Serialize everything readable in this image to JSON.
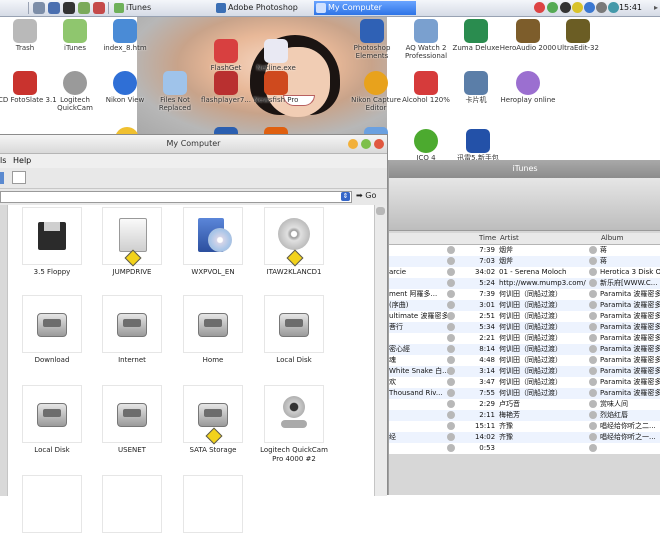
{
  "taskbar": {
    "tasks": [
      {
        "label": "iTunes"
      },
      {
        "label": "Adobe Photoshop"
      },
      {
        "label": "My Computer"
      }
    ],
    "clock": "15:41"
  },
  "desktop_icons": [
    {
      "label": "Trash"
    },
    {
      "label": "iTunes"
    },
    {
      "label": "index_8.htm"
    },
    {
      "label": "FlashGet"
    },
    {
      "label": "Netline.exe"
    },
    {
      "label": "Photoshop Elements"
    },
    {
      "label": "AQ Watch 2 Professional"
    },
    {
      "label": "Zuma Deluxe"
    },
    {
      "label": "HeroAudio 2000"
    },
    {
      "label": "UltraEdit-32"
    },
    {
      "label": "ACD FotoSlate 3.1"
    },
    {
      "label": "Logitech QuickCam"
    },
    {
      "label": "Nikon View"
    },
    {
      "label": "Files Not Replaced"
    },
    {
      "label": "flashplayer7..."
    },
    {
      "label": "Newsfish Pro"
    },
    {
      "label": "Nikon Capture Editor"
    },
    {
      "label": "Alcohol 120%"
    },
    {
      "label": "卡片机"
    },
    {
      "label": "Heroplay online"
    },
    {
      "label": "ICQ 4"
    },
    {
      "label": "迅雷5.新手包"
    }
  ],
  "my_computer": {
    "title": "My Computer",
    "menu": [
      "ls",
      "Help"
    ],
    "go_label": "Go",
    "drives": [
      {
        "label": "3.5 Floppy",
        "kind": "floppy-icon"
      },
      {
        "label": "JUMPDRIVE",
        "kind": "usb-drive-icon"
      },
      {
        "label": "WXPVOL_EN",
        "kind": "cd-install-icon"
      },
      {
        "label": "ITAW2KLANCD1",
        "kind": "cd-icon"
      },
      {
        "label": "Download",
        "kind": "hard-disk-icon"
      },
      {
        "label": "Internet",
        "kind": "hard-disk-icon"
      },
      {
        "label": "Home",
        "kind": "hard-disk-icon"
      },
      {
        "label": "Local Disk",
        "kind": "hard-disk-icon"
      },
      {
        "label": "Local Disk",
        "kind": "hard-disk-icon"
      },
      {
        "label": "USENET",
        "kind": "hard-disk-icon"
      },
      {
        "label": "SATA Storage",
        "kind": "hard-disk-icon"
      },
      {
        "label": "Logitech QuickCam Pro 4000 #2",
        "kind": "webcam-icon"
      }
    ]
  },
  "itunes": {
    "title": "iTunes",
    "columns": {
      "time": "Time",
      "artist": "Artist",
      "album": "Album"
    },
    "rows": [
      {
        "name": "",
        "time": "7:39",
        "artist": "烟斧",
        "album": "蒋"
      },
      {
        "name": "",
        "time": "7:03",
        "artist": "烟斧",
        "album": "蒋"
      },
      {
        "name": "arcie",
        "time": "34:02",
        "artist": "01 - Serena Moloch",
        "album": "Herotica 3 Disk One"
      },
      {
        "name": "",
        "time": "5:24",
        "artist": "http://www.mump3.com/",
        "album": "新乐府[WWW.C..."
      },
      {
        "name": "ment 阿羅多...",
        "time": "7:39",
        "artist": "何训田（同船过渡）",
        "album": "Paramita 波羅密多..."
      },
      {
        "name": "(序曲)",
        "time": "3:01",
        "artist": "何训田（同船过渡）",
        "album": "Paramita 波羅密多..."
      },
      {
        "name": "ultimate 波羅密多...",
        "time": "2:51",
        "artist": "何训田（同船过渡）",
        "album": "Paramita 波羅密多..."
      },
      {
        "name": "菩行",
        "time": "5:34",
        "artist": "何训田（同船过渡）",
        "album": "Paramita 波羅密多..."
      },
      {
        "name": "",
        "time": "2:21",
        "artist": "何训田（同船过渡）",
        "album": "Paramita 波羅密多..."
      },
      {
        "name": "密心經",
        "time": "8:14",
        "artist": "何训田（同船过渡）",
        "album": "Paramita 波羅密多..."
      },
      {
        "name": "魂",
        "time": "4:48",
        "artist": "何训田（同船过渡）",
        "album": "Paramita 波羅密多..."
      },
      {
        "name": "White Snake 白...",
        "time": "3:14",
        "artist": "何训田（同船过渡）",
        "album": "Paramita 波羅密多..."
      },
      {
        "name": "欢",
        "time": "3:47",
        "artist": "何训田（同船过渡）",
        "album": "Paramita 波羅密多..."
      },
      {
        "name": "Thousand Riv...",
        "time": "7:55",
        "artist": "何训田（同船过渡）",
        "album": "Paramita 波羅密多..."
      },
      {
        "name": "",
        "time": "2:29",
        "artist": "卢巧音",
        "album": "赏味人间"
      },
      {
        "name": "",
        "time": "2:11",
        "artist": "梅艳芳",
        "album": "烈焰红唇"
      },
      {
        "name": "",
        "time": "15:11",
        "artist": "齐豫",
        "album": "唱经给你听之二..."
      },
      {
        "name": "经",
        "time": "14:02",
        "artist": "齐豫",
        "album": "唱经给你听之一..."
      },
      {
        "name": "",
        "time": "0:53",
        "artist": "",
        "album": ""
      }
    ]
  }
}
